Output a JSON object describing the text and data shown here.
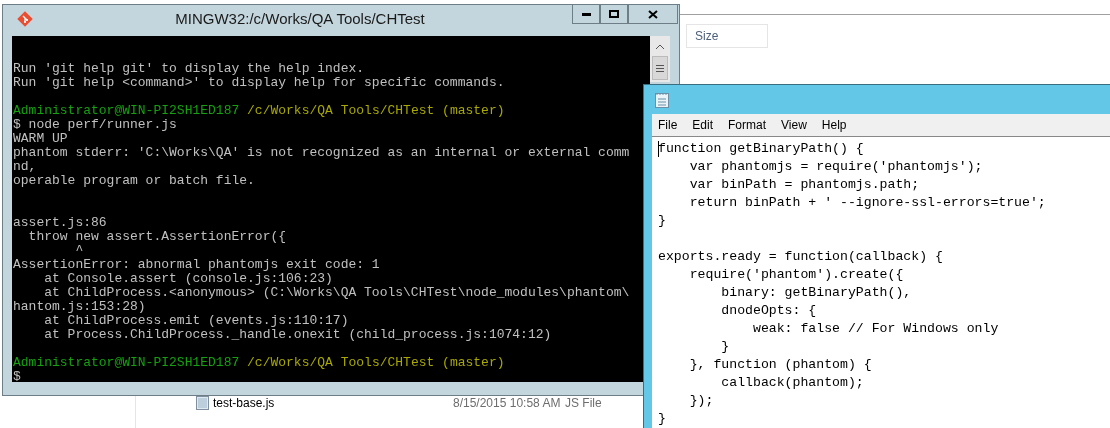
{
  "explorer": {
    "columns": [
      {
        "label": "Size"
      }
    ],
    "files": [
      {
        "name": "test-base.js",
        "modified": "8/15/2015 10:58 AM",
        "type": "JS File"
      }
    ]
  },
  "terminal": {
    "title": "MINGW32:/c/Works/QA Tools/CHTest",
    "lines": [
      {
        "kind": "text",
        "text": "Run 'git help git' to display the help index."
      },
      {
        "kind": "text",
        "text": "Run 'git help <command>' to display help for specific commands."
      },
      {
        "kind": "blank"
      },
      {
        "kind": "prompt",
        "user": "Administrator@WIN-PI2SH1ED187",
        "path": "/c/Works/QA Tools/CHTest (master)"
      },
      {
        "kind": "text",
        "text": "$ node perf/runner.js"
      },
      {
        "kind": "text",
        "text": "WARM UP"
      },
      {
        "kind": "text",
        "text": "phantom stderr: 'C:\\Works\\QA' is not recognized as an internal or external comm"
      },
      {
        "kind": "text",
        "text": "nd,"
      },
      {
        "kind": "text",
        "text": "operable program or batch file."
      },
      {
        "kind": "blank"
      },
      {
        "kind": "blank"
      },
      {
        "kind": "text",
        "text": "assert.js:86"
      },
      {
        "kind": "text",
        "text": "  throw new assert.AssertionError({"
      },
      {
        "kind": "text",
        "text": "        ^"
      },
      {
        "kind": "text",
        "text": "AssertionError: abnormal phantomjs exit code: 1"
      },
      {
        "kind": "text",
        "text": "    at Console.assert (console.js:106:23)"
      },
      {
        "kind": "text",
        "text": "    at ChildProcess.<anonymous> (C:\\Works\\QA Tools\\CHTest\\node_modules\\phantom\\"
      },
      {
        "kind": "text",
        "text": "hantom.js:153:28)"
      },
      {
        "kind": "text",
        "text": "    at ChildProcess.emit (events.js:110:17)"
      },
      {
        "kind": "text",
        "text": "    at Process.ChildProcess._handle.onexit (child_process.js:1074:12)"
      },
      {
        "kind": "blank"
      },
      {
        "kind": "prompt",
        "user": "Administrator@WIN-PI2SH1ED187",
        "path": "/c/Works/QA Tools/CHTest (master)"
      },
      {
        "kind": "text",
        "text": "$"
      }
    ]
  },
  "notepad": {
    "menu": [
      "File",
      "Edit",
      "Format",
      "View",
      "Help"
    ],
    "lines": [
      {
        "kind": "code",
        "text": "function getBinaryPath() {"
      },
      {
        "kind": "code",
        "text": "    var phantomjs = require('phantomjs');"
      },
      {
        "kind": "code",
        "text": "    var binPath = phantomjs.path;"
      },
      {
        "kind": "code",
        "text": "    return binPath + ' --ignore-ssl-errors=true';"
      },
      {
        "kind": "code",
        "text": "}"
      },
      {
        "kind": "blank"
      },
      {
        "kind": "code",
        "text": "exports.ready = function(callback) {"
      },
      {
        "kind": "code",
        "text": "    require('phantom').create({"
      },
      {
        "kind": "code",
        "text": "        binary: getBinaryPath(),"
      },
      {
        "kind": "code",
        "text": "        dnodeOpts: {"
      },
      {
        "kind": "code",
        "text": "            weak: false // For Windows only"
      },
      {
        "kind": "code",
        "text": "        }"
      },
      {
        "kind": "code",
        "text": "    }, function (phantom) {"
      },
      {
        "kind": "code",
        "text": "        callback(phantom);"
      },
      {
        "kind": "code",
        "text": "    });"
      },
      {
        "kind": "code",
        "text": "}"
      }
    ]
  }
}
